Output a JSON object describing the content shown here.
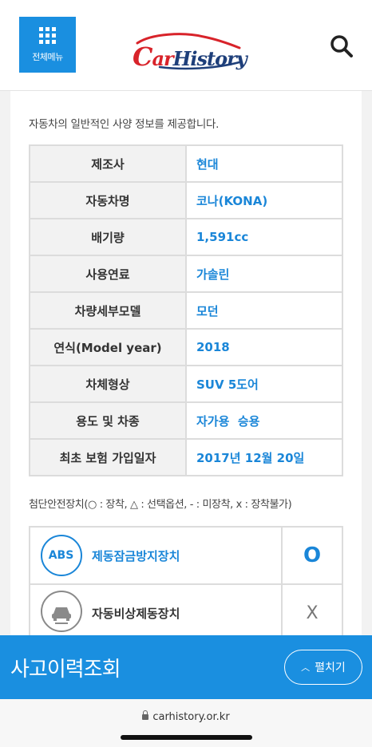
{
  "header": {
    "menu_label": "전체메뉴",
    "logo_text_c": "C",
    "logo_text_ar": "ar",
    "logo_text_history": "History"
  },
  "intro": "자동차의 일반적인 사양 정보를 제공합니다.",
  "specs": [
    {
      "label": "제조사",
      "value": "현대"
    },
    {
      "label": "자동차명",
      "value": "코나(KONA)"
    },
    {
      "label": "배기량",
      "value": "1,591cc"
    },
    {
      "label": "사용연료",
      "value": "가솔린"
    },
    {
      "label": "차량세부모델",
      "value": "모던"
    },
    {
      "label": "연식(Model year)",
      "value": "2018"
    },
    {
      "label": "차체형상",
      "value": "SUV 5도어"
    },
    {
      "label": "용도 및 차종",
      "value": "자가용  승용"
    },
    {
      "label": "최초 보험 가입일자",
      "value": "2017년 12월 20일"
    }
  ],
  "safety_note": "첨단안전장치(○ : 장착, △ : 선택옵션, - : 미장착, x : 장착불가)",
  "safety": [
    {
      "icon_text": "ABS",
      "icon": "abs-icon",
      "name": "제동잠금방지장치",
      "status": "O"
    },
    {
      "icon": "car-brake-icon",
      "name": "자동비상제동장치",
      "status": "X"
    }
  ],
  "accident_bar": {
    "title": "사고이력조회",
    "expand_label": "펼치기"
  },
  "browser": {
    "url": "carhistory.or.kr"
  },
  "colors": {
    "accent": "#1a8fe0",
    "value_blue": "#1a86d8",
    "logo_red": "#d8232a",
    "logo_navy": "#1e3f7a"
  }
}
